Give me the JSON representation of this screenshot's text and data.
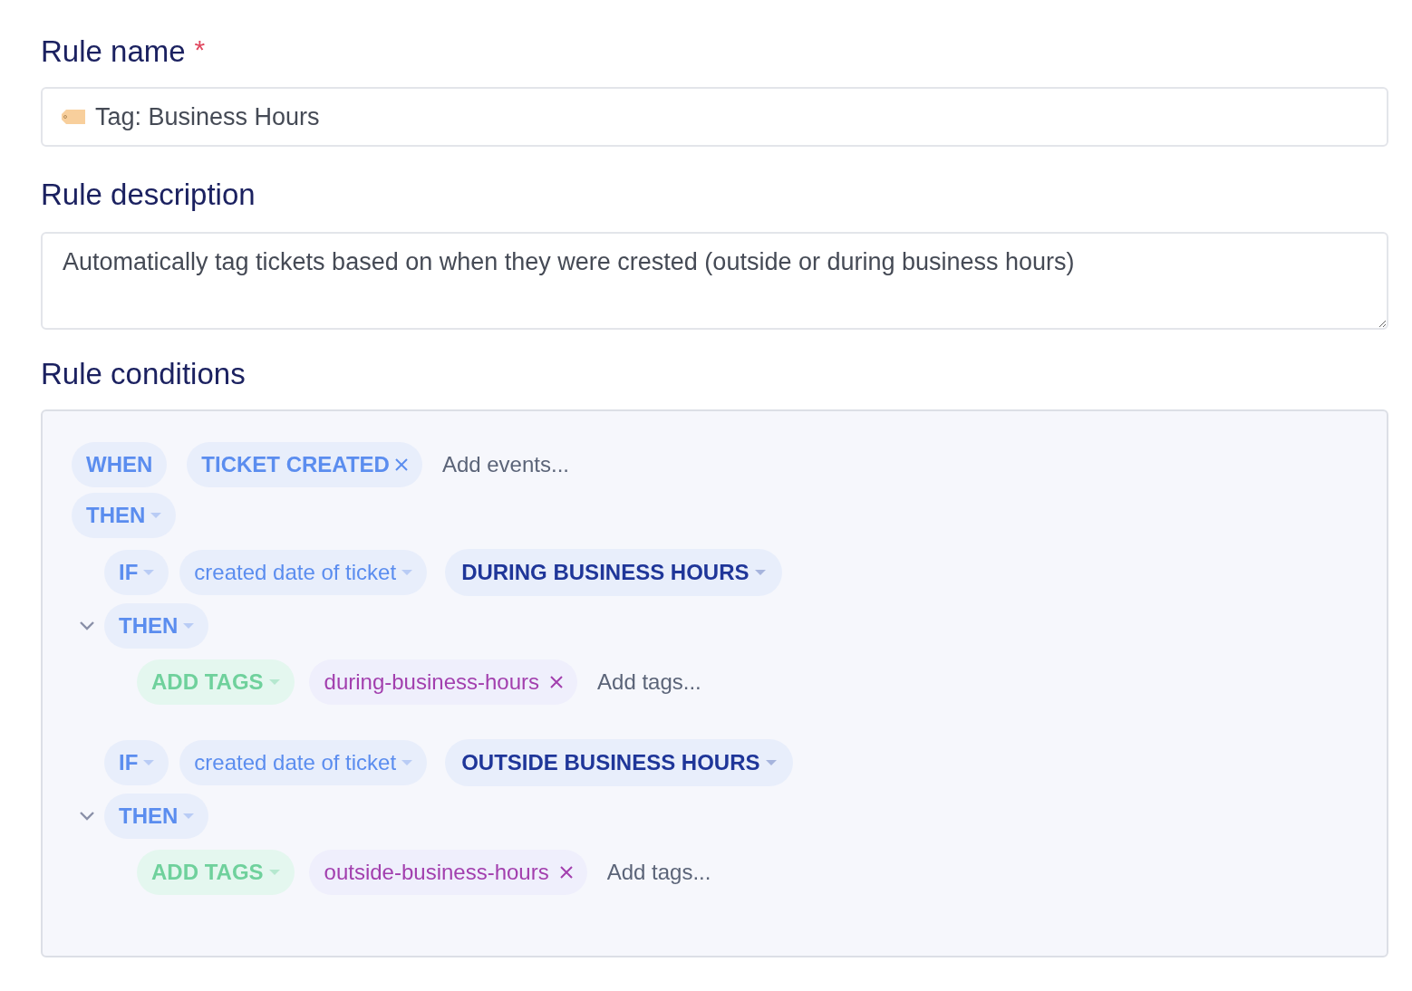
{
  "rule_name": {
    "label": "Rule name",
    "required": true,
    "required_mark": "*",
    "value": "Tag: Business Hours"
  },
  "rule_description": {
    "label": "Rule description",
    "value": "Automatically tag tickets based on when they were crested (outside or during business hours)"
  },
  "rule_conditions": {
    "label": "Rule conditions",
    "when": {
      "label": "WHEN",
      "events": [
        {
          "label": "TICKET CREATED"
        }
      ],
      "placeholder": "Add events..."
    },
    "then": {
      "label": "THEN"
    },
    "branches": [
      {
        "if": {
          "label": "IF",
          "field": "created date of ticket",
          "value": "DURING BUSINESS HOURS"
        },
        "then": {
          "label": "THEN",
          "expanded": true,
          "action": "ADD TAGS",
          "tags": [
            {
              "label": "during-business-hours"
            }
          ],
          "placeholder": "Add tags..."
        }
      },
      {
        "if": {
          "label": "IF",
          "field": "created date of ticket",
          "value": "OUTSIDE BUSINESS HOURS"
        },
        "then": {
          "label": "THEN",
          "expanded": true,
          "action": "ADD TAGS",
          "tags": [
            {
              "label": "outside-business-hours"
            }
          ],
          "placeholder": "Add tags..."
        }
      }
    ]
  }
}
